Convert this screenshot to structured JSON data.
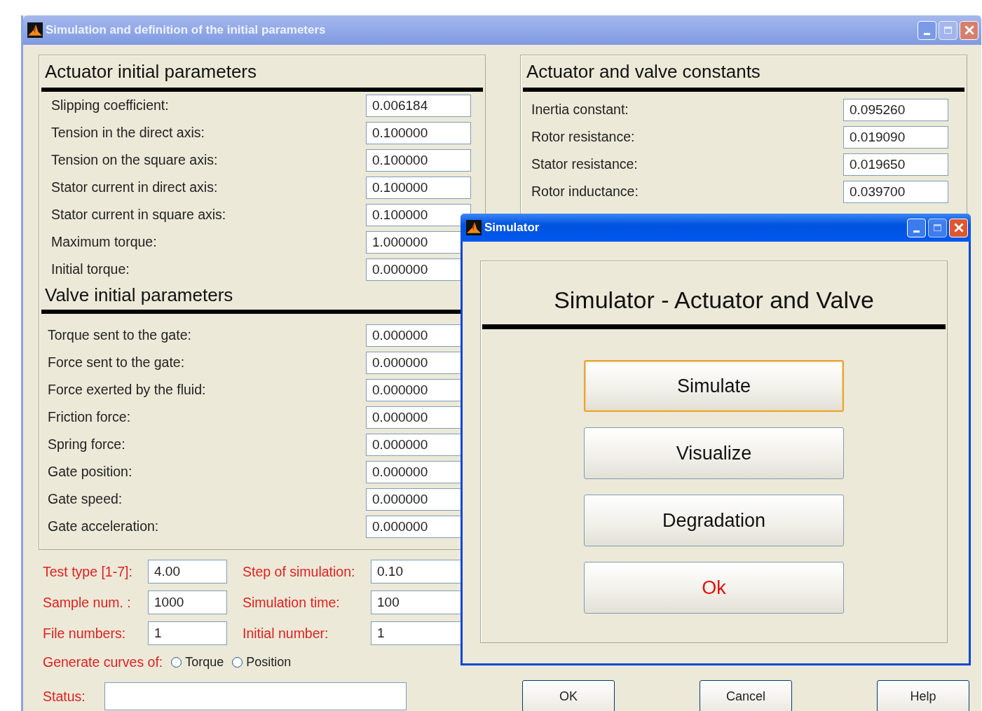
{
  "window": {
    "title": "Simulation and definition of the initial parameters"
  },
  "actuator_panel": {
    "title": "Actuator initial parameters",
    "rows": [
      {
        "label": "Slipping coefficient:",
        "value": "0.006184"
      },
      {
        "label": "Tension in the direct axis:",
        "value": "0.100000"
      },
      {
        "label": "Tension on the square axis:",
        "value": "0.100000"
      },
      {
        "label": "Stator current in direct axis:",
        "value": "0.100000"
      },
      {
        "label": "Stator current in square axis:",
        "value": "0.100000"
      },
      {
        "label": "Maximum torque:",
        "value": "1.000000"
      },
      {
        "label": "Initial torque:",
        "value": "0.000000"
      }
    ]
  },
  "valve_panel": {
    "title": "Valve initial parameters",
    "rows": [
      {
        "label": "Torque sent to the gate:",
        "value": "0.000000"
      },
      {
        "label": "Force sent to the gate:",
        "value": "0.000000"
      },
      {
        "label": "Force exerted by the fluid:",
        "value": "0.000000"
      },
      {
        "label": "Friction force:",
        "value": "0.000000"
      },
      {
        "label": "Spring force:",
        "value": "0.000000"
      },
      {
        "label": "Gate position:",
        "value": "0.000000"
      },
      {
        "label": "Gate speed:",
        "value": "0.000000"
      },
      {
        "label": "Gate acceleration:",
        "value": "0.000000"
      }
    ]
  },
  "constants_panel": {
    "title": "Actuator and valve constants",
    "rows": [
      {
        "label": "Inertia constant:",
        "value": "0.095260"
      },
      {
        "label": "Rotor resistance:",
        "value": "0.019090"
      },
      {
        "label": "Stator resistance:",
        "value": "0.019650"
      },
      {
        "label": "Rotor inductance:",
        "value": "0.039700"
      }
    ]
  },
  "settings": [
    [
      {
        "label": "Test type [1-7]:",
        "value": "4.00"
      },
      {
        "label": "Step of simulation:",
        "value": "0.10"
      }
    ],
    [
      {
        "label": "Sample num. :",
        "value": "1000"
      },
      {
        "label": "Simulation time:",
        "value": "100"
      }
    ],
    [
      {
        "label": "File numbers:",
        "value": "1"
      },
      {
        "label": "Initial number:",
        "value": "1"
      }
    ]
  ],
  "curves": {
    "label": "Generate curves of:",
    "options": [
      {
        "label": "Torque",
        "selected": false
      },
      {
        "label": "Position",
        "selected": false
      }
    ]
  },
  "status": {
    "label": "Status:"
  },
  "buttons": [
    "OK",
    "Cancel",
    "Help"
  ],
  "dialog": {
    "title": "Simulator",
    "heading": "Simulator - Actuator and Valve",
    "buttons": [
      {
        "label": "Simulate",
        "focused": true,
        "alert": false
      },
      {
        "label": "Visualize",
        "focused": false,
        "alert": false
      },
      {
        "label": "Degradation",
        "focused": false,
        "alert": false
      },
      {
        "label": "Ok",
        "focused": false,
        "alert": true
      }
    ]
  }
}
